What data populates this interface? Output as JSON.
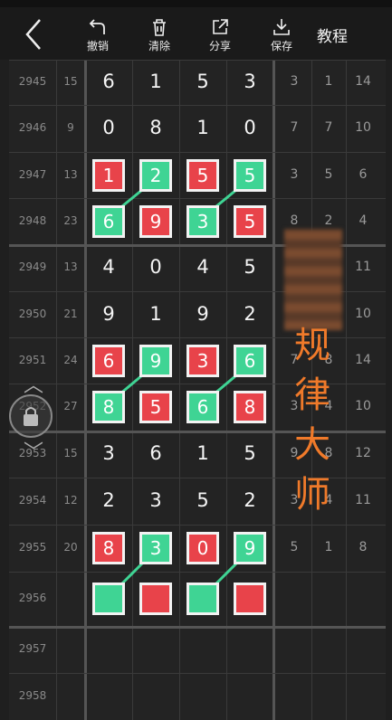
{
  "toolbar": {
    "undo": "撤销",
    "clear": "清除",
    "share": "分享",
    "save": "保存",
    "tutorial": "教程"
  },
  "rows": [
    {
      "period": "2945",
      "gap": "15",
      "digits": [
        "6",
        "1",
        "5",
        "3"
      ],
      "right": [
        "3",
        "1",
        "14"
      ]
    },
    {
      "period": "2946",
      "gap": "9",
      "digits": [
        "0",
        "8",
        "1",
        "0"
      ],
      "right": [
        "7",
        "7",
        "10"
      ]
    },
    {
      "period": "2947",
      "gap": "13",
      "digits": [
        "1",
        "2",
        "5",
        "5"
      ],
      "right": [
        "3",
        "5",
        "6"
      ]
    },
    {
      "period": "2948",
      "gap": "23",
      "digits": [
        "6",
        "9",
        "3",
        "5"
      ],
      "right": [
        "8",
        "2",
        "4"
      ]
    },
    {
      "period": "2949",
      "gap": "13",
      "digits": [
        "4",
        "0",
        "4",
        "5"
      ],
      "right": [
        "",
        "",
        "11"
      ]
    },
    {
      "period": "2950",
      "gap": "21",
      "digits": [
        "9",
        "1",
        "9",
        "2"
      ],
      "right": [
        "",
        "",
        "10"
      ]
    },
    {
      "period": "2951",
      "gap": "24",
      "digits": [
        "6",
        "9",
        "3",
        "6"
      ],
      "right": [
        "7",
        "8",
        "14"
      ]
    },
    {
      "period": "2952",
      "gap": "27",
      "digits": [
        "8",
        "5",
        "6",
        "8"
      ],
      "right": [
        "3",
        "4",
        "10"
      ]
    },
    {
      "period": "2953",
      "gap": "15",
      "digits": [
        "3",
        "6",
        "1",
        "5"
      ],
      "right": [
        "9",
        "8",
        "12"
      ]
    },
    {
      "period": "2954",
      "gap": "12",
      "digits": [
        "2",
        "3",
        "5",
        "2"
      ],
      "right": [
        "3",
        "4",
        "11"
      ]
    },
    {
      "period": "2955",
      "gap": "20",
      "digits": [
        "8",
        "3",
        "0",
        "9"
      ],
      "right": [
        "5",
        "1",
        "8"
      ]
    },
    {
      "period": "2956",
      "gap": "",
      "digits": [
        "",
        "",
        "",
        ""
      ],
      "right": [
        "",
        "",
        ""
      ]
    },
    {
      "period": "2957",
      "gap": "",
      "digits": [
        "",
        "",
        "",
        ""
      ],
      "right": [
        "",
        "",
        ""
      ]
    },
    {
      "period": "2958",
      "gap": "",
      "digits": [
        "",
        "",
        "",
        ""
      ],
      "right": [
        "",
        "",
        ""
      ]
    }
  ],
  "watermark": [
    "规",
    "律",
    "大",
    "师"
  ],
  "colors": {
    "red": "#e8434a",
    "green": "#3fd494",
    "accent": "#f07a2a"
  }
}
